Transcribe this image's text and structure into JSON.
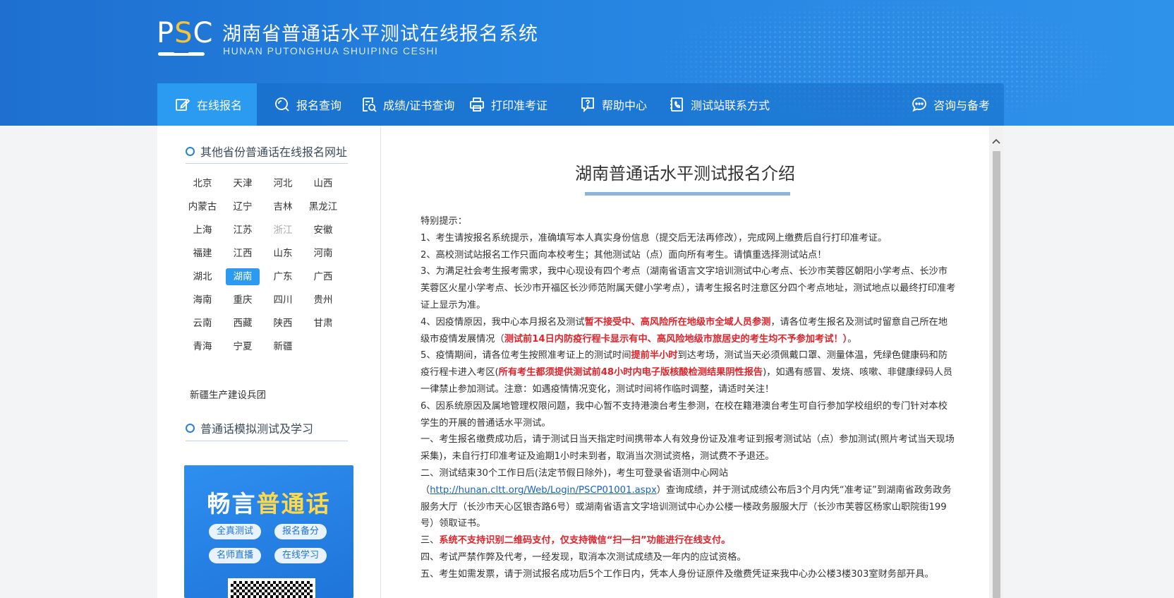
{
  "header": {
    "logo_text": "PSC",
    "title_cn": "湖南省普通话水平测试在线报名系统",
    "title_en": "HUNAN PUTONGHUA SHUIPING CESHI"
  },
  "nav": {
    "items": [
      {
        "label": "在线报名",
        "icon": "edit-icon",
        "active": true
      },
      {
        "label": "报名查询",
        "icon": "search-icon"
      },
      {
        "label": "成绩/证书查询",
        "icon": "certificate-search-icon"
      },
      {
        "label": "打印准考证",
        "icon": "printer-icon"
      },
      {
        "label": "帮助中心",
        "icon": "help-icon"
      },
      {
        "label": "测试站联系方式",
        "icon": "phone-book-icon"
      },
      {
        "label": "咨询与备考",
        "icon": "chat-icon"
      }
    ]
  },
  "sidebar": {
    "provinces_title": "其他省份普通话在线报名网址",
    "provinces": [
      "北京",
      "天津",
      "河北",
      "山西",
      "内蒙古",
      "辽宁",
      "吉林",
      "黑龙江",
      "上海",
      "江苏",
      "浙江",
      "安徽",
      "福建",
      "江西",
      "山东",
      "河南",
      "湖北",
      "湖南",
      "广东",
      "广西",
      "海南",
      "重庆",
      "四川",
      "贵州",
      "云南",
      "西藏",
      "陕西",
      "甘肃",
      "青海",
      "宁夏",
      "新疆"
    ],
    "active_province": "湖南",
    "disabled_province": "浙江",
    "bingtuan": "新疆生产建设兵团",
    "study_title": "普通话模拟测试及学习",
    "promo": {
      "title_white": "畅言",
      "title_yellow": "普通话",
      "pills": [
        "全真测试",
        "报名备分",
        "名师直播",
        "在线学习"
      ]
    }
  },
  "content": {
    "title": "湖南普通话水平测试报名介绍",
    "intro": "特别提示：",
    "p1": "1、考生请按报名系统提示，准确填写本人真实身份信息（提交后无法再修改），完成网上缴费后自行打印准考证。",
    "p2": "2、高校测试站报名工作只面向本校考生；其他测试站（点）面向所有考生。请慎重选择测试站点！",
    "p3": "3、为满足社会考生报考需求，我中心现设有四个考点（湖南省语言文字培训测试中心考点、长沙市芙蓉区朝阳小学考点、长沙市芙蓉区火星小学考点、长沙市开福区长沙师范附属天健小学考点），请考生报名时注意区分四个考点地址，测试地点以最终打印准考证上显示为准。",
    "p4_a": "4、因疫情原因，我中心本月报名及测试",
    "p4_red1": "暂不接受中、高风险所在地级市全域人员参测",
    "p4_b": "，请各位考生报名及测试时留意自己所在地级市疫情发展情况（",
    "p4_red2": "测试前14日内防疫行程卡显示有中、高风险地级市旅居史的考生均不予参加考试！）",
    "p4_c": "。",
    "p5_a": "5、疫情期间，请各位考生按照准考证上的测试时间",
    "p5_red1": "提前半小时",
    "p5_b": "到达考场，测试当天必须佩戴口罩、测量体温，凭绿色健康码和防疫行程卡进入考区(",
    "p5_red2": "所有考生都须提供测试前48小时内电子版核酸检测结果阴性报告",
    "p5_c": ")，如遇有感冒、发烧、咳嗽、非健康绿码人员一律禁止参加测试。注意：如遇疫情情况变化，测试时间将作临时调整，请适时关注！",
    "p6": "6、因系统原因及属地管理权限问题，我中心暂不支持港澳台考生参测，在校在籍港澳台考生可自行参加学校组织的专门针对本校学生的开展的普通话水平测试。",
    "q1": "一、考生报名缴费成功后，请于测试日当天指定时间携带本人有效身份证及准考证到报考测试站（点）参加测试(照片考试当天现场采集)，未自行打印准考证及逾期1小时未到者，取消当次测试资格，测试费不予退还。",
    "q2_a": "二、测试结束30个工作日后(法定节假日除外)，考生可登录省语测中心网站（",
    "q2_link": "http://hunan.cltt.org/Web/Login/PSCP01001.aspx",
    "q2_b": "）查询成绩，并于测试成绩公布后3个月内凭“准考证”到湖南省政务政务服务大厅（长沙市天心区银杏路6号）或湖南省语言文字培训测试中心办公楼一楼政务服服大厅（长沙市芙蓉区杨家山职院街199号）领取证书。",
    "q3_a": "三、",
    "q3_red": "系统不支持识别二维码支付，仅支持微信“扫一扫”功能进行在线支付。",
    "q4": "四、考试严禁作弊及代考，一经发现，取消本次测试成绩及一年内的应试资格。",
    "q5": "五、考生如需发票，请于测试报名成功后5个工作日内，凭本人身份证原件及缴费凭证来我中心办公楼3楼303室财务部开具。"
  },
  "colors": {
    "header_blue": "#1e6fd0",
    "nav_active": "#2a9bf0",
    "alert_red": "#e0242b",
    "logo_yellow": "#f3c43c"
  }
}
